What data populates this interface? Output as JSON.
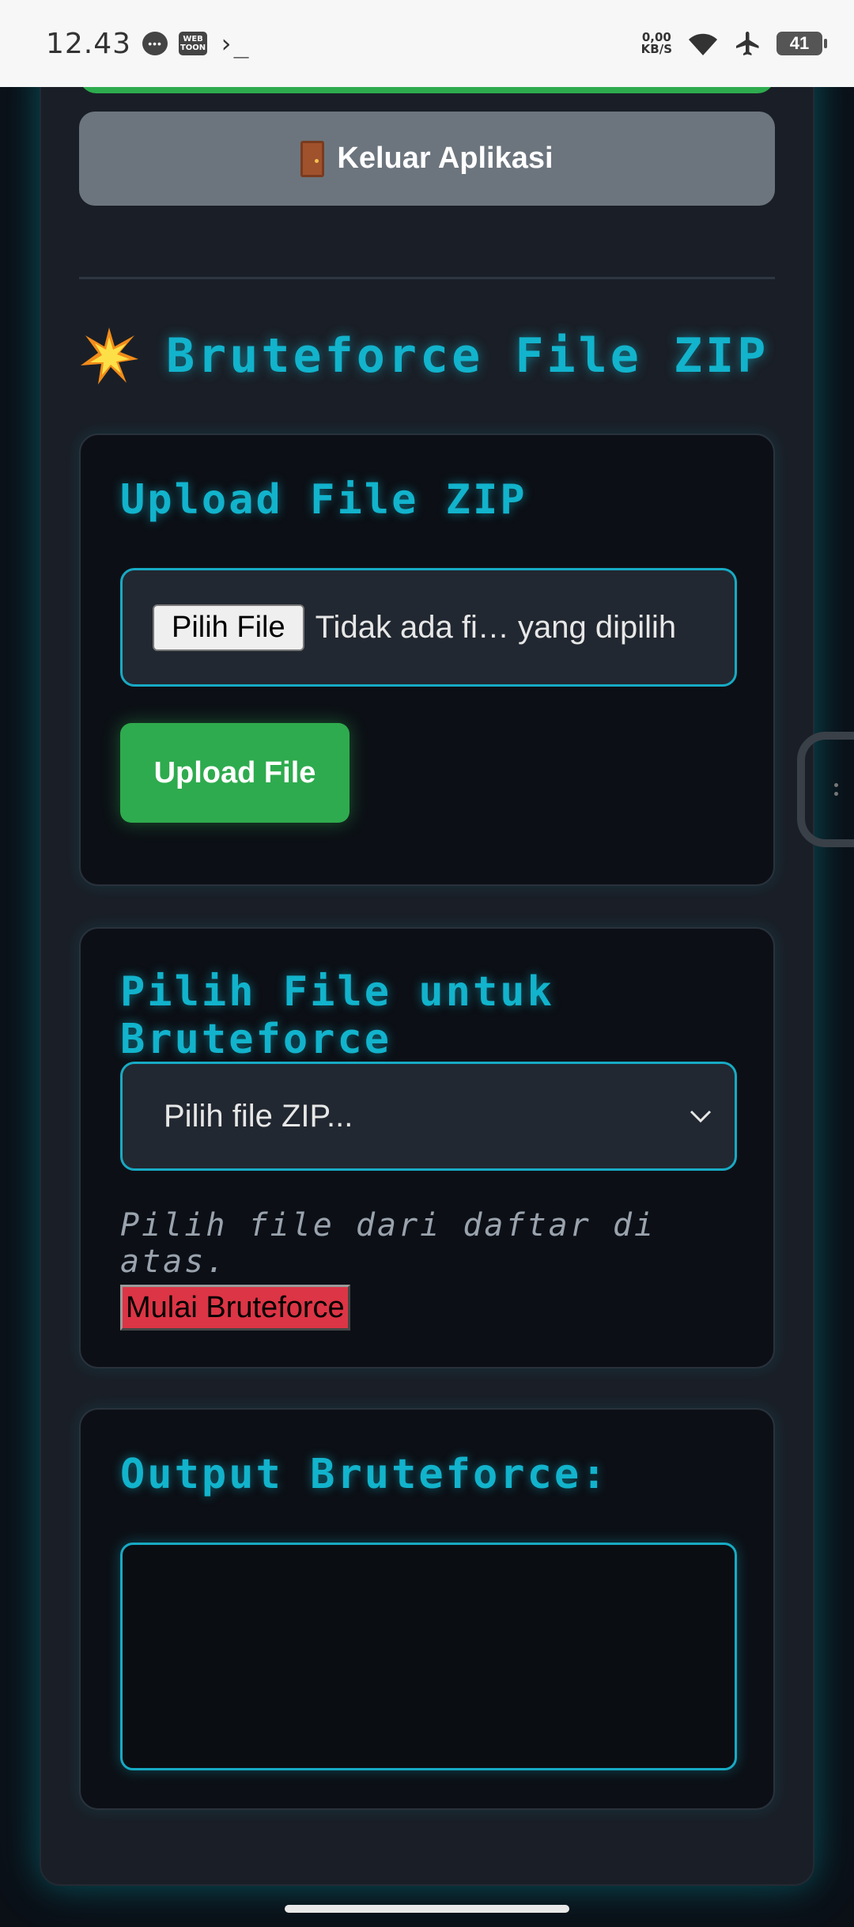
{
  "status_bar": {
    "time": "12.43",
    "speed_value": "0,00",
    "speed_unit": "KB/S",
    "battery": "41",
    "icons": [
      "chat-icon",
      "webtoon-icon",
      "terminal-icon",
      "wifi-icon",
      "airplane-icon",
      "battery-icon"
    ],
    "webtoon_label": "WEB TOON"
  },
  "exit_button": {
    "label": "Keluar Aplikasi",
    "icon": "door-icon"
  },
  "section": {
    "title": "Bruteforce File ZIP",
    "icon": "collision-burst-icon"
  },
  "upload_panel": {
    "title": "Upload File ZIP",
    "choose_label": "Pilih File",
    "no_file_text": "Tidak ada fi… yang dipilih",
    "upload_label": "Upload File"
  },
  "select_panel": {
    "title": "Pilih File untuk Bruteforce",
    "selected_option": "Pilih file ZIP...",
    "hint": "Pilih file dari daftar di atas.",
    "start_label": "Mulai Bruteforce"
  },
  "output_panel": {
    "title": "Output Bruteforce:",
    "output_value": ""
  },
  "colors": {
    "accent_cyan": "#12b3cc",
    "success_green": "#2eab4e",
    "danger_red": "#dc3545",
    "secondary_gray": "#6c757d",
    "background": "#0b1017"
  }
}
